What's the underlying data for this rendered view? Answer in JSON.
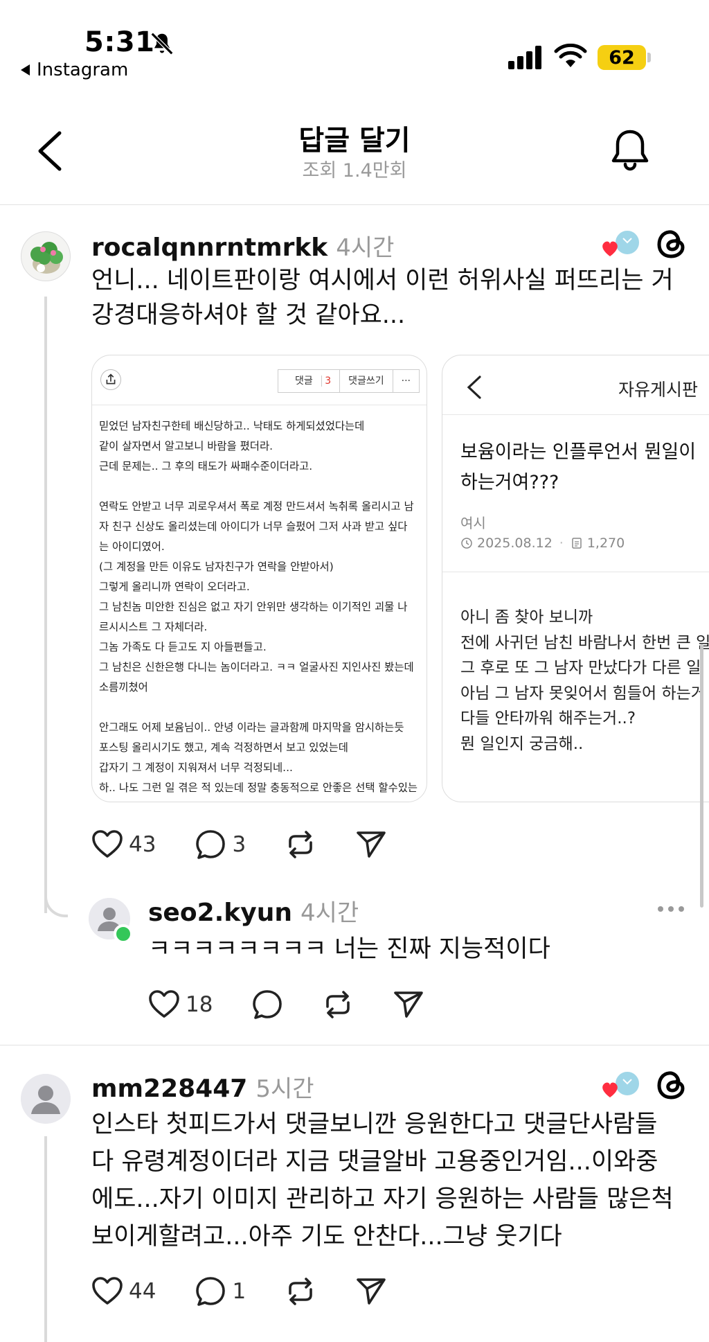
{
  "status_bar": {
    "time": "5:31",
    "back_app": "Instagram",
    "battery": "62"
  },
  "header": {
    "title": "답글 달기",
    "subtitle": "조회 1.4만회"
  },
  "posts": [
    {
      "username": "rocalqnnrntmrkk",
      "time": "4시간",
      "text_lines": [
        "언니... 네이트판이랑 여시에서 이런 허위사실 퍼뜨리는 거",
        "강경대응하셔야 할 것 같아요..."
      ],
      "likes": "43",
      "comments": "3"
    },
    {
      "username": "seo2.kyun",
      "time": "4시간",
      "text_lines": [
        "ㅋㅋㅋㅋㅋㅋㅋㅋ 너는 진짜 지능적이다"
      ],
      "likes": "18",
      "comments": ""
    },
    {
      "username": "mm228447",
      "time": "5시간",
      "text_lines": [
        "인스타 첫피드가서 댓글보니깐 응원한다고 댓글단사람들",
        "다 유령계정이더라 지금 댓글알바 고용중인거임...이와중",
        "에도...자기 이미지 관리하고 자기 응원하는 사람들 많은척",
        "보이게할려고...아주 기도 안찬다...그냥 웃기다"
      ],
      "likes": "44",
      "comments": "1"
    }
  ],
  "card1": {
    "btn_comment": "댓글",
    "btn_comment_count": "3",
    "btn_write": "댓글쓰기",
    "btn_more": "···",
    "lines": [
      "믿었던 남자친구한테 배신당하고.. 낙태도 하게되셨었다는데",
      "같이 살자면서 알고보니 바람을 폈더라.",
      "근데 문제는.. 그 후의 태도가 싸패수준이더라고.",
      "",
      "연락도 안받고 너무 괴로우셔서 폭로 계정 만드셔서 녹취록 올리시고 남",
      "자 친구 신상도 올리셨는데 아이디가 너무 슬펐어 그저 사과 받고 싶다",
      "는 아이디였어.",
      "(그 계정을 만든 이유도 남자친구가 연락을 안받아서)",
      "그렇게 올리니까 연락이 오더라고.",
      "그 남친놈 미안한 진심은 없고 자기 안위만 생각하는 이기적인 괴물 나",
      "르시시스트 그 자체더라.",
      "그놈 가족도 다 듣고도 지 아들편들고.",
      "그 남친은 신한은행 다니는 놈이더라고. ㅋㅋ 얼굴사진 지인사진 봤는데",
      "소름끼쳤어",
      "",
      "안그래도 어제 보윰님이.. 안녕 이라는 글과함께 마지막을 암시하는듯",
      "포스팅 올리시기도 했고, 계속 걱정하면서 보고 있었는데",
      "갑자기 그 계정이 지워져서 너무 걱정되네...",
      "하.. 나도 그런 일 겪은 적 있는데 정말 충동적으로 안좋은 선택 할수있는"
    ]
  },
  "card2": {
    "board": "자유게시판",
    "title_lines": [
      "보윰이라는 인플루언서 뭔일이",
      "하는거여???"
    ],
    "category": "여시",
    "date": "2025.08.12",
    "views": "1,270",
    "body_lines": [
      "아니 좀 찾아 보니까",
      "전에 사귀던 남친 바람나서 한번 큰 일",
      "그 후로 또 그 남자 만났다가 다른 일",
      "아님 그 남자 못잊어서 힘들어 하는거",
      "다들 안타까워 해주는거..?",
      "뭔 일인지 궁금해.."
    ]
  },
  "colors": {
    "accent_red": "#ff2d40",
    "online_green": "#34c759",
    "battery_yellow": "#f5cf12",
    "muted_text": "#999999"
  },
  "icons": [
    "bell-slash-icon",
    "signal-icon",
    "wifi-icon",
    "battery-icon",
    "chevron-left-icon",
    "bell-icon",
    "heart-icon",
    "comment-icon",
    "repost-icon",
    "send-icon",
    "threads-icon",
    "more-icon"
  ]
}
